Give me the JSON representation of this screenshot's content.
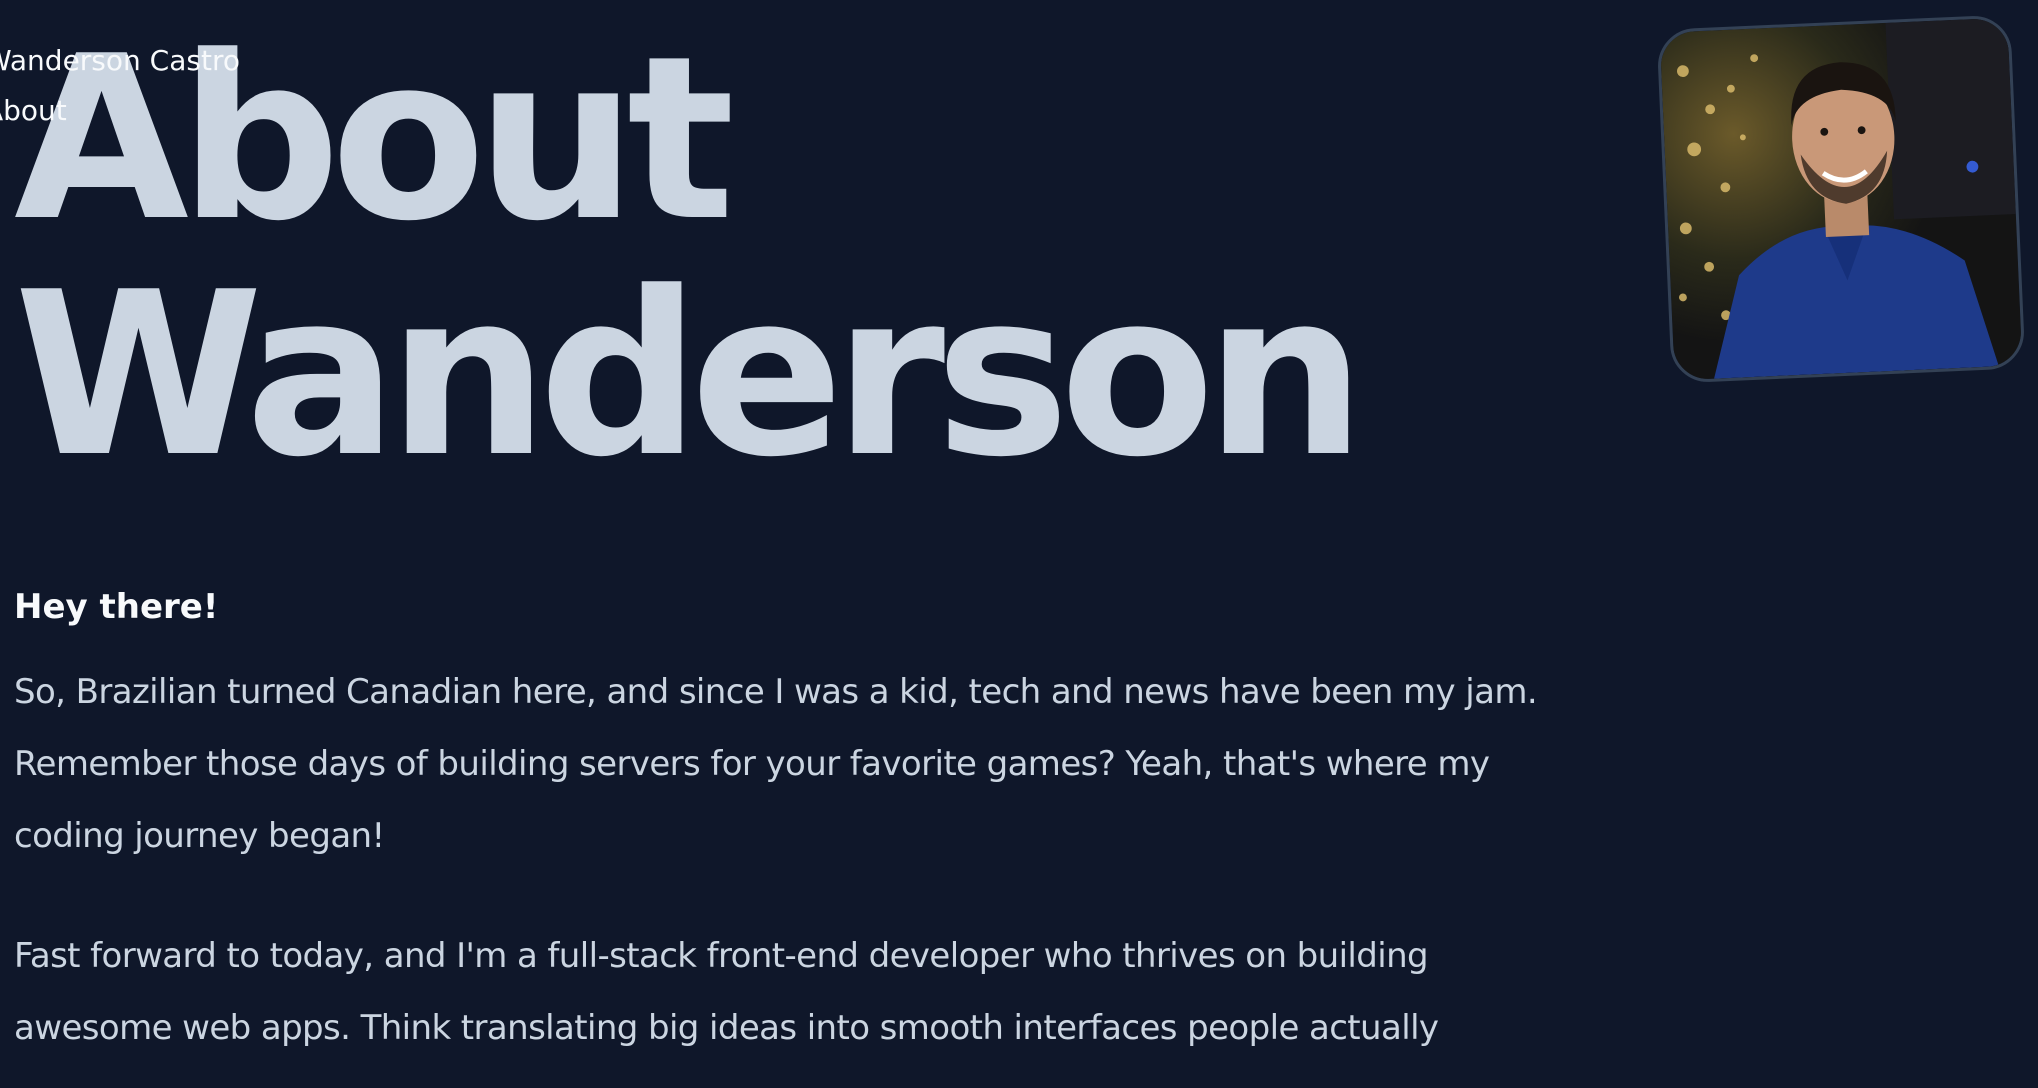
{
  "nav": {
    "name": "Wanderson Castro",
    "about": "About"
  },
  "hero": {
    "line1": "About",
    "line2": "Wanderson"
  },
  "content": {
    "greeting": "Hey there!",
    "paragraphs": [
      "So, Brazilian turned Canadian here, and since I was a kid, tech and news have been my jam. Remember those days of building servers for your favorite games? Yeah, that's where my coding journey began!",
      "Fast forward to today, and I'm a full-stack front-end developer who thrives on building awesome web apps. Think translating big ideas into smooth interfaces people actually"
    ]
  },
  "colors": {
    "background": "#0f172a",
    "heading": "#cbd5e1",
    "text": "#cbd5e1",
    "highlight": "#f8fafc",
    "avatar_border": "#334155"
  },
  "avatar": {
    "icon": "profile-photo"
  }
}
